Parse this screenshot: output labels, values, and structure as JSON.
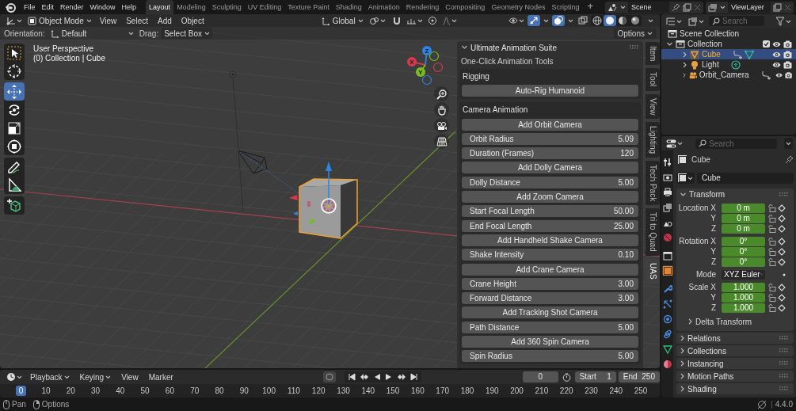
{
  "top_bar": {
    "menus": [
      "File",
      "Edit",
      "Render",
      "Window",
      "Help"
    ],
    "workspaces": [
      {
        "label": "Layout",
        "selected": true
      },
      {
        "label": "Modeling",
        "selected": false
      },
      {
        "label": "Sculpting",
        "selected": false
      },
      {
        "label": "UV Editing",
        "selected": false
      },
      {
        "label": "Texture Paint",
        "selected": false
      },
      {
        "label": "Shading",
        "selected": false
      },
      {
        "label": "Animation",
        "selected": false
      },
      {
        "label": "Rendering",
        "selected": false
      },
      {
        "label": "Compositing",
        "selected": false
      },
      {
        "label": "Geometry Nodes",
        "selected": false
      },
      {
        "label": "Scripting",
        "selected": false
      }
    ],
    "add_workspace": "+",
    "scene": "Scene",
    "view_layer": "ViewLayer"
  },
  "viewport": {
    "header": {
      "mode": "Object Mode",
      "menus": [
        "View",
        "Select",
        "Add",
        "Object"
      ],
      "orientation": "Global",
      "toggles": [
        {
          "kind": "snap",
          "on": false
        },
        {
          "kind": "proportional",
          "on": false
        },
        {
          "kind": "visibility",
          "on": false
        },
        {
          "kind": "gizmo",
          "on": true
        },
        {
          "kind": "overlay",
          "on": true
        },
        {
          "kind": "xray",
          "on": false
        }
      ],
      "shading": [
        {
          "kind": "wireframe",
          "selected": false
        },
        {
          "kind": "solid",
          "selected": true
        },
        {
          "kind": "material",
          "selected": false
        },
        {
          "kind": "rendered",
          "selected": false
        }
      ]
    },
    "tool_settings": {
      "orientation_label": "Orientation:",
      "orientation": "Default",
      "drag_label": "Drag:",
      "drag": "Select Box",
      "options": "Options"
    },
    "tool_groups": [
      [
        {
          "kind": "select",
          "selected": false
        },
        {
          "kind": "cursor",
          "selected": false
        }
      ],
      [
        {
          "kind": "move",
          "selected": true
        },
        {
          "kind": "rotate",
          "selected": false
        },
        {
          "kind": "scale",
          "selected": false
        },
        {
          "kind": "transform",
          "selected": false
        }
      ],
      [
        {
          "kind": "annotate",
          "selected": false
        },
        {
          "kind": "measure",
          "selected": false
        }
      ],
      [
        {
          "kind": "add_cube",
          "selected": false
        }
      ]
    ],
    "info": [
      "User Perspective",
      "(0) Collection | Cube"
    ],
    "axes": [
      {
        "label": "X",
        "color": "#d5394e"
      },
      {
        "label": "Y",
        "color": "#7cbd1c"
      },
      {
        "label": "Z",
        "color": "#2f84e3"
      }
    ],
    "navigation": [
      {
        "kind": "zoom"
      },
      {
        "kind": "pan"
      },
      {
        "kind": "camera"
      },
      {
        "kind": "ortho"
      }
    ]
  },
  "n_panel": {
    "title": "Ultimate Animation Suite",
    "subtitle": "One-Click Animation Tools",
    "sections": [
      {
        "title": "Rigging",
        "rows": [
          {
            "kind": "button",
            "label": "Auto-Rig Humanoid"
          }
        ]
      },
      {
        "title": "Camera Animation",
        "rows": [
          {
            "kind": "button",
            "label": "Add Orbit Camera"
          },
          {
            "kind": "field",
            "label": "Orbit Radius",
            "value": "5.09"
          },
          {
            "kind": "field",
            "label": "Duration (Frames)",
            "value": "120"
          },
          {
            "kind": "button",
            "label": "Add Dolly Camera"
          },
          {
            "kind": "field",
            "label": "Dolly Distance",
            "value": "5.00"
          },
          {
            "kind": "button",
            "label": "Add Zoom Camera"
          },
          {
            "kind": "field",
            "label": "Start Focal Length",
            "value": "50.00"
          },
          {
            "kind": "field",
            "label": "End Focal Length",
            "value": "25.00"
          },
          {
            "kind": "button",
            "label": "Add Handheld Shake Camera"
          },
          {
            "kind": "field",
            "label": "Shake Intensity",
            "value": "0.10"
          },
          {
            "kind": "button",
            "label": "Add Crane Camera"
          },
          {
            "kind": "field",
            "label": "Crane Height",
            "value": "3.00"
          },
          {
            "kind": "field",
            "label": "Forward Distance",
            "value": "3.00"
          },
          {
            "kind": "button",
            "label": "Add Tracking Shot Camera"
          },
          {
            "kind": "field",
            "label": "Path Distance",
            "value": "5.00"
          },
          {
            "kind": "button",
            "label": "Add 360 Spin Camera"
          },
          {
            "kind": "field",
            "label": "Spin Radius",
            "value": "5.00"
          }
        ]
      }
    ]
  },
  "sidebar_tabs": [
    {
      "label": "Item",
      "selected": false
    },
    {
      "label": "Tool",
      "selected": false
    },
    {
      "label": "View",
      "selected": false
    },
    {
      "label": "Lighting",
      "selected": false
    },
    {
      "label": "Tech Pack",
      "selected": false
    },
    {
      "label": "Tri to Quad",
      "selected": false
    },
    {
      "label": "UAS",
      "selected": true
    }
  ],
  "outliner": {
    "search_placeholder": "Search",
    "root": "Scene Collection",
    "tree": [
      {
        "label": "Collection",
        "kind": "collection",
        "expanded": true,
        "checked": true,
        "selected": false,
        "children": [
          {
            "label": "Cube",
            "kind": "mesh",
            "expanded": false,
            "selected": true,
            "badges": [
              {
                "kind": "constraint"
              },
              {
                "kind": "mesh_data"
              }
            ]
          },
          {
            "label": "Light",
            "kind": "light",
            "expanded": false,
            "selected": false,
            "badges": [
              {
                "kind": "light_data"
              }
            ]
          },
          {
            "label": "Orbit_Camera",
            "kind": "camera",
            "expanded": false,
            "selected": false,
            "badges": [
              {
                "kind": "constraint"
              }
            ]
          }
        ]
      }
    ]
  },
  "properties": {
    "search_placeholder": "Search",
    "tabs": [
      {
        "kind": "tool",
        "selected": false
      },
      {
        "kind": "render",
        "selected": false
      },
      {
        "kind": "output",
        "selected": false
      },
      {
        "kind": "view_layer",
        "selected": false
      },
      {
        "kind": "scene",
        "selected": false
      },
      {
        "kind": "world",
        "selected": false
      },
      {
        "kind": "collection",
        "selected": false
      },
      {
        "kind": "object",
        "selected": true
      },
      {
        "kind": "modifiers",
        "selected": false
      },
      {
        "kind": "particles",
        "selected": false
      },
      {
        "kind": "physics",
        "selected": false
      },
      {
        "kind": "constraints",
        "selected": false
      },
      {
        "kind": "data",
        "selected": false
      },
      {
        "kind": "material",
        "selected": false
      }
    ],
    "object": "Cube",
    "data": "Cube",
    "transform": {
      "title": "Transform",
      "expanded": true,
      "groups": [
        [
          {
            "kind": "field",
            "label": "Location X",
            "value": "0 m",
            "animated": true
          },
          {
            "kind": "field",
            "label": "Y",
            "value": "0 m",
            "animated": true
          },
          {
            "kind": "field",
            "label": "Z",
            "value": "0 m",
            "animated": true
          }
        ],
        [
          {
            "kind": "field",
            "label": "Rotation X",
            "value": "0°",
            "animated": true
          },
          {
            "kind": "field",
            "label": "Y",
            "value": "0°",
            "animated": true
          },
          {
            "kind": "field",
            "label": "Z",
            "value": "0°",
            "animated": true
          }
        ],
        [
          {
            "kind": "dropdown",
            "label": "Mode",
            "value": "XYZ Euler"
          }
        ],
        [
          {
            "kind": "field",
            "label": "Scale X",
            "value": "1.000",
            "animated": true
          },
          {
            "kind": "field",
            "label": "Y",
            "value": "1.000",
            "animated": true
          },
          {
            "kind": "field",
            "label": "Z",
            "value": "1.000",
            "animated": true
          }
        ]
      ],
      "subpanels": [
        {
          "label": "Delta Transform",
          "expanded": false
        }
      ]
    },
    "panels": [
      {
        "label": "Relations",
        "expanded": false
      },
      {
        "label": "Collections",
        "expanded": false
      },
      {
        "label": "Instancing",
        "expanded": false
      },
      {
        "label": "Motion Paths",
        "expanded": false
      },
      {
        "label": "Shading",
        "expanded": false
      }
    ]
  },
  "timeline": {
    "menus": [
      "Playback",
      "Keying",
      "View",
      "Marker"
    ],
    "frame": "0",
    "start_label": "Start",
    "start": "1",
    "end_label": "End",
    "end": "250",
    "ruler": [
      {
        "label": "0",
        "selected": true
      },
      {
        "label": "10",
        "selected": false
      },
      {
        "label": "20",
        "selected": false
      },
      {
        "label": "30",
        "selected": false
      },
      {
        "label": "40",
        "selected": false
      },
      {
        "label": "50",
        "selected": false
      },
      {
        "label": "60",
        "selected": false
      },
      {
        "label": "70",
        "selected": false
      },
      {
        "label": "80",
        "selected": false
      },
      {
        "label": "90",
        "selected": false
      },
      {
        "label": "100",
        "selected": false
      },
      {
        "label": "110",
        "selected": false
      },
      {
        "label": "120",
        "selected": false
      },
      {
        "label": "130",
        "selected": false
      },
      {
        "label": "140",
        "selected": false
      },
      {
        "label": "150",
        "selected": false
      },
      {
        "label": "160",
        "selected": false
      },
      {
        "label": "170",
        "selected": false
      },
      {
        "label": "180",
        "selected": false
      },
      {
        "label": "190",
        "selected": false
      },
      {
        "label": "200",
        "selected": false
      },
      {
        "label": "210",
        "selected": false
      },
      {
        "label": "220",
        "selected": false
      },
      {
        "label": "230",
        "selected": false
      },
      {
        "label": "240",
        "selected": false
      },
      {
        "label": "250",
        "selected": false
      }
    ]
  },
  "status_bar": {
    "hints": [
      "Pan",
      "Options"
    ],
    "version": "4.4.0"
  }
}
